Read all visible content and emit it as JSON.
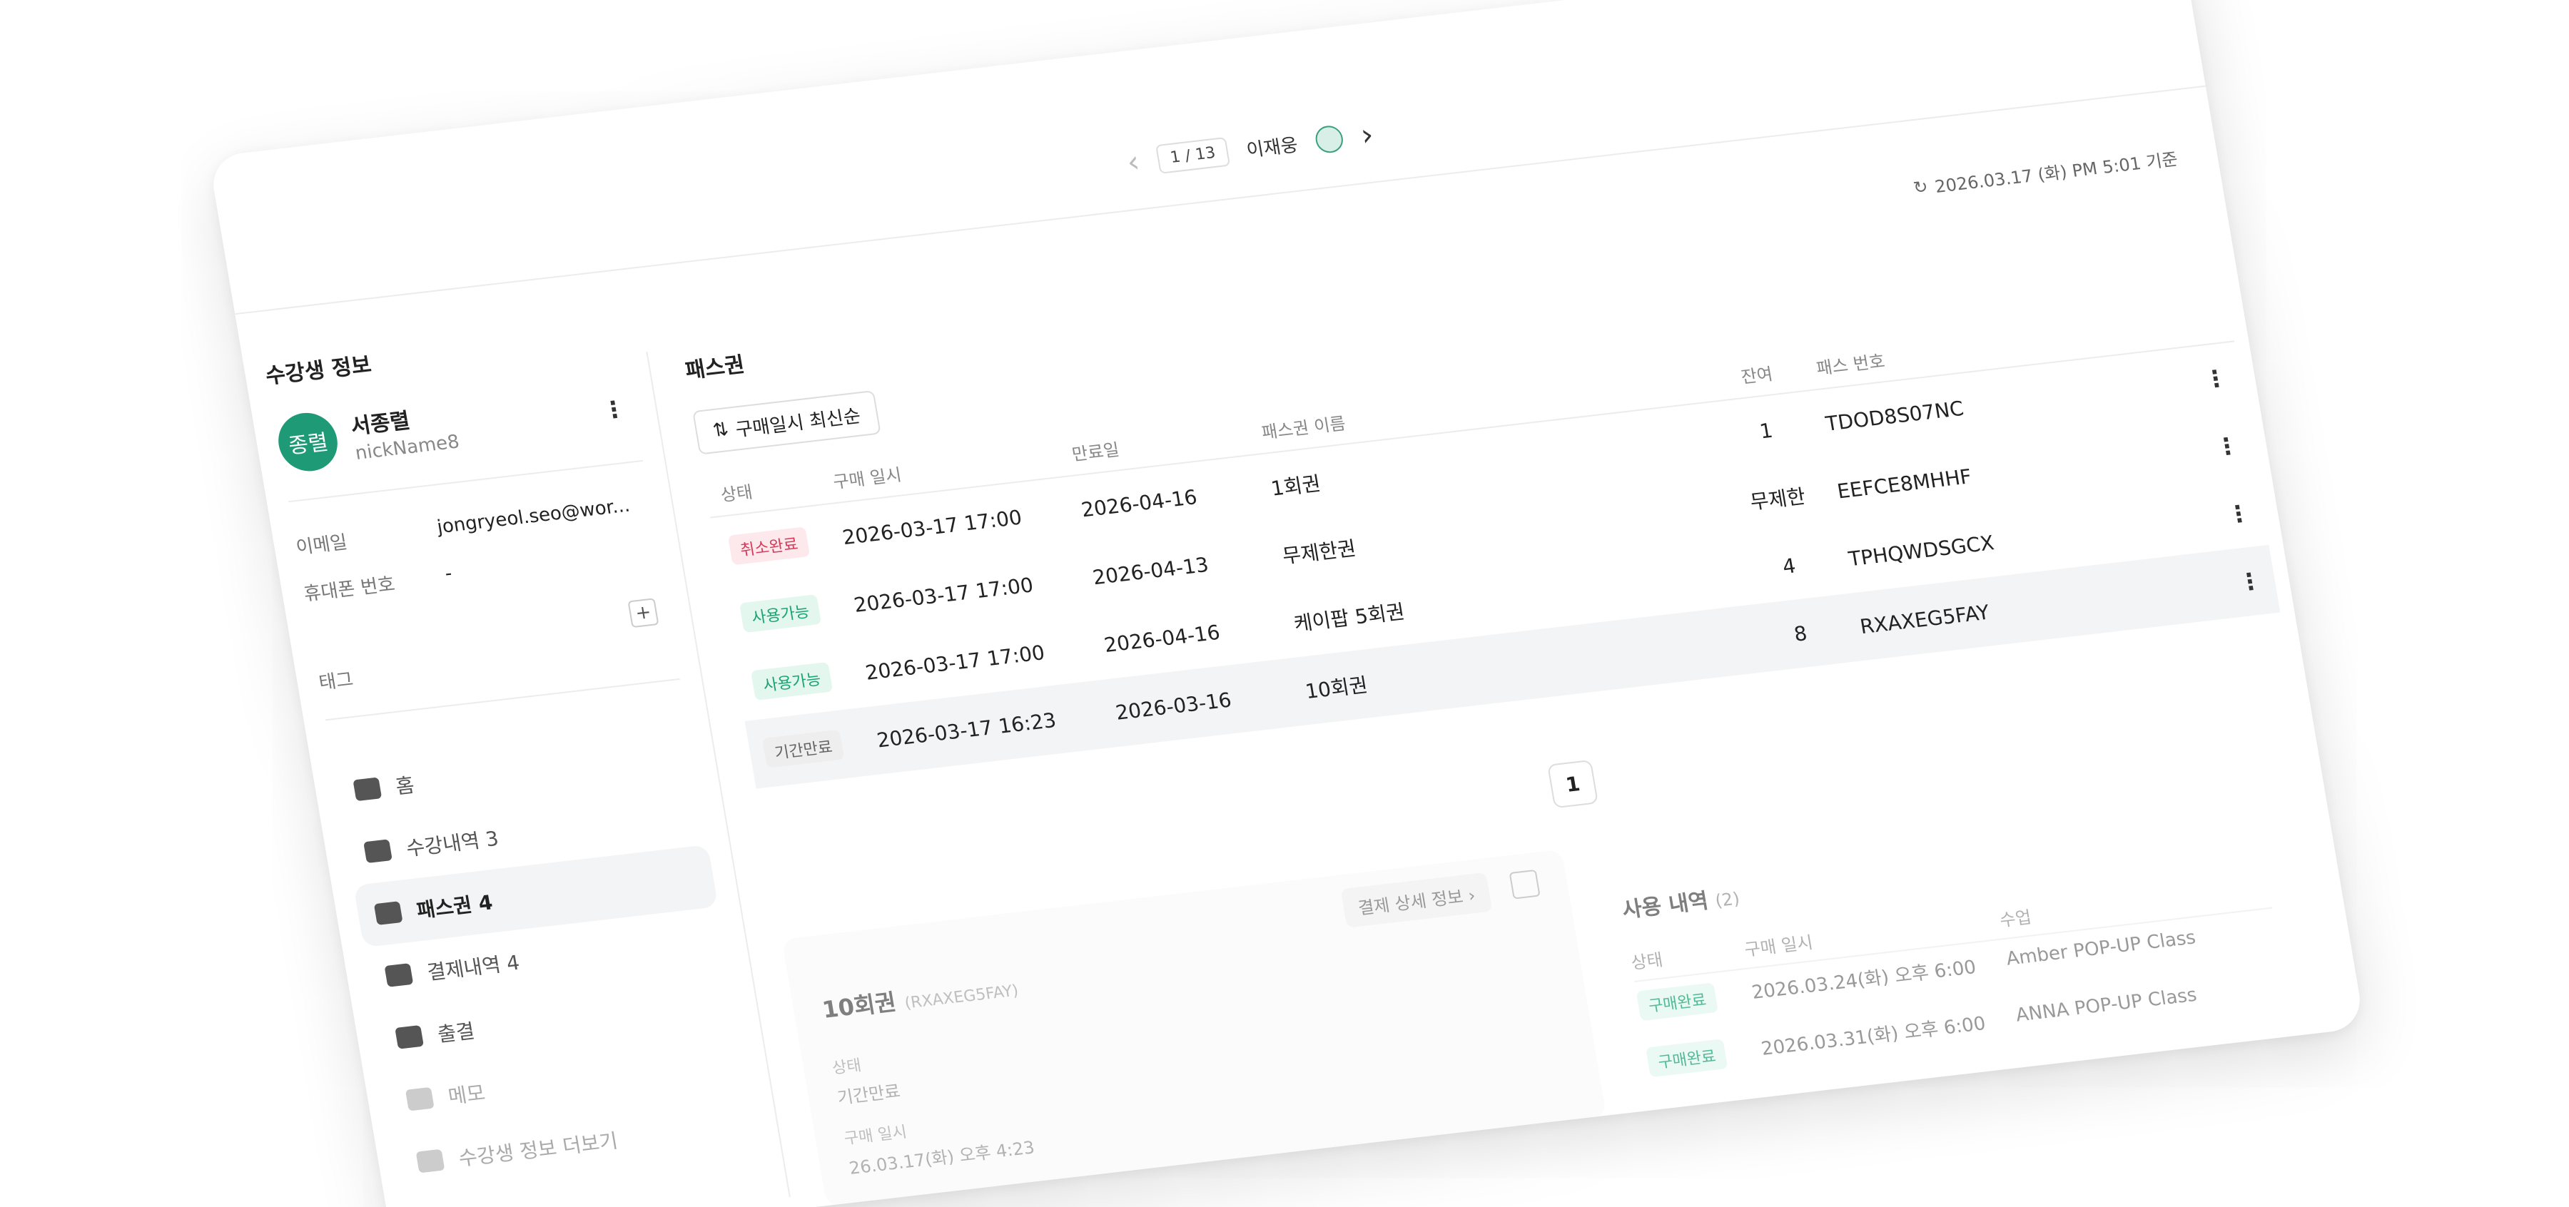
{
  "modal": {
    "title": "수강생 정보",
    "pager": "1 / 13",
    "nav_name": "이재웅",
    "timestamp": "2026.03.17 (화) PM 5:01 기준"
  },
  "profile": {
    "avatar_text": "종렬",
    "name": "서종렬",
    "nickname": "nickName8",
    "email_label": "이메일",
    "email": "jongryeol.seo@wor...",
    "phone_label": "휴대폰 번호",
    "phone": "-",
    "tag_label": "태그",
    "tag_add": "+"
  },
  "menu": [
    {
      "label": "홈",
      "icon": "home-icon"
    },
    {
      "label": "수강내역 3",
      "icon": "ticket-icon"
    },
    {
      "label": "패스권 4",
      "icon": "pass-icon"
    },
    {
      "label": "결제내역 4",
      "icon": "receipt-icon"
    },
    {
      "label": "출결",
      "icon": "calendar-icon"
    },
    {
      "label": "메모",
      "icon": "memo-icon"
    },
    {
      "label": "수강생 정보 더보기",
      "icon": "user-icon"
    }
  ],
  "pass": {
    "section_title": "패스권",
    "sort_label": "구매일시 최신순",
    "headers": {
      "status": "상태",
      "purchase": "구매 일시",
      "expire": "만료일",
      "name": "패스권 이름",
      "remain": "잔여",
      "number": "패스 번호"
    },
    "rows": [
      {
        "status": "취소완료",
        "purchase": "2026-03-17 17:00",
        "expire": "2026-04-16",
        "name": "1회권",
        "remain": "1",
        "number": "TDOD8S07NC"
      },
      {
        "status": "사용가능",
        "purchase": "2026-03-17 17:00",
        "expire": "2026-04-13",
        "name": "무제한권",
        "remain": "무제한",
        "number": "EEFCE8MHHF"
      },
      {
        "status": "사용가능",
        "purchase": "2026-03-17 17:00",
        "expire": "2026-04-16",
        "name": "케이팝 5회권",
        "remain": "4",
        "number": "TPHQWDSGCX"
      },
      {
        "status": "기간만료",
        "purchase": "2026-03-17 16:23",
        "expire": "2026-03-16",
        "name": "10회권",
        "remain": "8",
        "number": "RXAXEG5FAY"
      }
    ],
    "page": "1"
  },
  "detail": {
    "title": "10회권",
    "code": "(RXAXEG5FAY)",
    "button": "결제 상세 정보",
    "status_label": "상태",
    "status_value": "기간만료",
    "purchase_label": "구매 일시",
    "purchase_value": "26.03.17(화) 오후 4:23"
  },
  "usage": {
    "title": "사용 내역",
    "count": "(2)",
    "headers": {
      "status": "상태",
      "purchase": "구매 일시",
      "class": "수업"
    },
    "rows": [
      {
        "status": "구매완료",
        "purchase": "2026.03.24(화) 오후 6:00",
        "class": "Amber POP-UP Class"
      },
      {
        "status": "구매완료",
        "purchase": "2026.03.31(화) 오후 6:00",
        "class": "ANNA POP-UP Class"
      }
    ]
  }
}
